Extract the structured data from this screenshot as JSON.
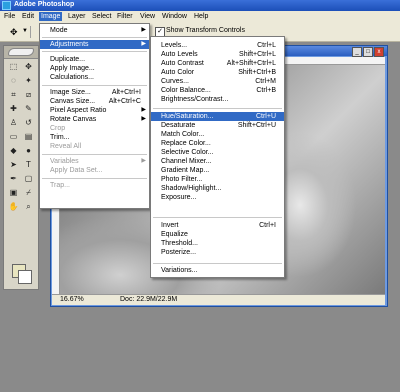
{
  "app": {
    "title": "Adobe Photoshop"
  },
  "menubar": [
    "File",
    "Edit",
    "Image",
    "Layer",
    "Select",
    "Filter",
    "View",
    "Window",
    "Help"
  ],
  "options": {
    "checkbox_label": "Show Transform Controls",
    "checked": true
  },
  "document": {
    "zoom": "16.67%",
    "doc_info": "Doc: 22.9M/22.9M"
  },
  "image_menu": {
    "items": [
      {
        "label": "Mode",
        "arrow": "▶"
      },
      {
        "label": "Adjustments",
        "arrow": "▶",
        "highlight": true
      },
      {
        "label": "Duplicate..."
      },
      {
        "label": "Apply Image..."
      },
      {
        "label": "Calculations..."
      },
      {
        "label": "Image Size...",
        "shortcut": "Alt+Ctrl+I"
      },
      {
        "label": "Canvas Size...",
        "shortcut": "Alt+Ctrl+C"
      },
      {
        "label": "Pixel Aspect Ratio",
        "arrow": "▶"
      },
      {
        "label": "Rotate Canvas",
        "arrow": "▶"
      },
      {
        "label": "Crop",
        "disabled": true
      },
      {
        "label": "Trim..."
      },
      {
        "label": "Reveal All",
        "disabled": true
      },
      {
        "label": "Variables",
        "arrow": "▶",
        "disabled": true
      },
      {
        "label": "Apply Data Set...",
        "disabled": true
      },
      {
        "label": "Trap...",
        "disabled": true
      }
    ]
  },
  "adjustments_menu": {
    "items": [
      {
        "label": "Levels...",
        "shortcut": "Ctrl+L"
      },
      {
        "label": "Auto Levels",
        "shortcut": "Shift+Ctrl+L"
      },
      {
        "label": "Auto Contrast",
        "shortcut": "Alt+Shift+Ctrl+L"
      },
      {
        "label": "Auto Color",
        "shortcut": "Shift+Ctrl+B"
      },
      {
        "label": "Curves...",
        "shortcut": "Ctrl+M"
      },
      {
        "label": "Color Balance...",
        "shortcut": "Ctrl+B"
      },
      {
        "label": "Brightness/Contrast..."
      },
      {
        "label": "Hue/Saturation...",
        "shortcut": "Ctrl+U",
        "highlight": true
      },
      {
        "label": "Desaturate",
        "shortcut": "Shift+Ctrl+U"
      },
      {
        "label": "Match Color..."
      },
      {
        "label": "Replace Color..."
      },
      {
        "label": "Selective Color..."
      },
      {
        "label": "Channel Mixer..."
      },
      {
        "label": "Gradient Map..."
      },
      {
        "label": "Photo Filter..."
      },
      {
        "label": "Shadow/Highlight..."
      },
      {
        "label": "Exposure..."
      },
      {
        "label": "Invert",
        "shortcut": "Ctrl+I"
      },
      {
        "label": "Equalize"
      },
      {
        "label": "Threshold..."
      },
      {
        "label": "Posterize..."
      },
      {
        "label": "Variations..."
      }
    ]
  }
}
